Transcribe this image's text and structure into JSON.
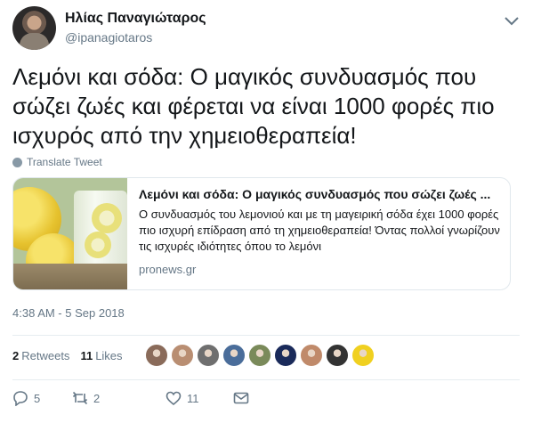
{
  "author": {
    "name": "Ηλίας Παναγιώταρος",
    "handle": "@ipanagiotaros"
  },
  "tweet": {
    "text": "Λεμόνι και σόδα: Ο μαγικός συνδυασμός που σώζει ζωές και φέρεται να είναι 1000 φορές πιο ισχυρός από την χημειοθεραπεία!",
    "translate_label": "Translate Tweet",
    "timestamp": "4:38 AM - 5 Sep 2018"
  },
  "card": {
    "title": "Λεμόνι και σόδα: Ο μαγικός συνδυασμός που σώζει ζωές ...",
    "description": "Ο συνδυασμός του λεμονιού και με τη μαγειρική σόδα έχει 1000 φορές πιο ισχυρή επίδραση από τη χημειοθεραπεία!  Όντας πολλοί γνωρίζουν τις ισχυρές ιδιότητες όπου το λεμόνι",
    "domain": "pronews.gr"
  },
  "stats": {
    "retweets_count": "2",
    "retweets_label": "Retweets",
    "likes_count": "11",
    "likes_label": "Likes"
  },
  "likers": [
    {
      "icon": "liker-avatar",
      "color": "#8a6b5a"
    },
    {
      "icon": "liker-avatar",
      "color": "#b98e72"
    },
    {
      "icon": "liker-avatar",
      "color": "#6f6f6f"
    },
    {
      "icon": "liker-avatar",
      "color": "#4a6d9a"
    },
    {
      "icon": "liker-avatar",
      "color": "#7a8a5a"
    },
    {
      "icon": "liker-avatar",
      "color": "#1a2a5a"
    },
    {
      "icon": "liker-avatar",
      "color": "#c08a6a"
    },
    {
      "icon": "liker-avatar",
      "color": "#333333"
    },
    {
      "icon": "liker-avatar",
      "color": "#f0d020"
    }
  ],
  "actions": {
    "reply_count": "5",
    "retweet_count": "2",
    "like_count": "11"
  },
  "colors": {
    "text": "#14171a",
    "secondary": "#657786",
    "border": "#e1e8ed"
  }
}
